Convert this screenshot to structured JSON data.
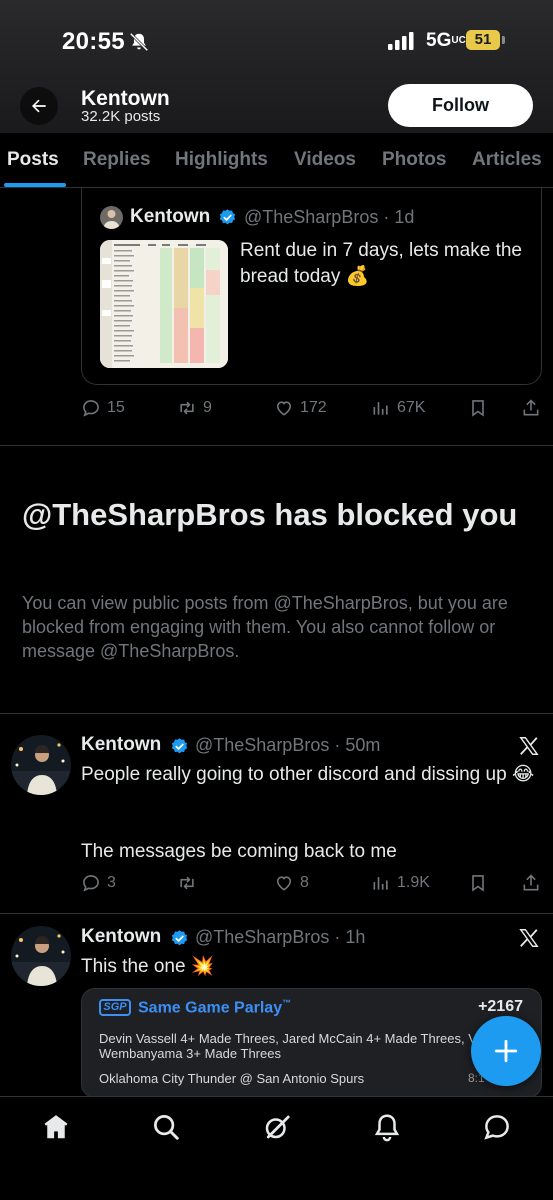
{
  "status_bar": {
    "time": "20:55",
    "network": "5G",
    "network_suffix": "UC",
    "battery": "51",
    "battery_color": "#e8c94a"
  },
  "header": {
    "back_icon": "arrow-left-icon",
    "name": "Kentown",
    "posts_count": "32.2K posts",
    "follow_label": "Follow"
  },
  "tabs": [
    {
      "label": "Posts",
      "active": true
    },
    {
      "label": "Replies"
    },
    {
      "label": "Highlights"
    },
    {
      "label": "Videos"
    },
    {
      "label": "Photos"
    },
    {
      "label": "Articles"
    }
  ],
  "accent_color": "#1d9bf0",
  "quoted_post": {
    "name": "Kentown",
    "handle": "@TheSharpBros · 1d",
    "text": "Rent due in 7 days, lets make the bread today 💰",
    "stats": {
      "replies": "15",
      "reposts": "9",
      "likes": "172",
      "views": "67K"
    }
  },
  "blocked": {
    "title": "@TheSharpBros has blocked you",
    "description": "You can view public posts from @TheSharpBros, but you are blocked from engaging with them. You also cannot follow or message @TheSharpBros."
  },
  "posts": [
    {
      "name": "Kentown",
      "handle": "@TheSharpBros · 50m",
      "line1": "People really going to other discord and dissing up 😂",
      "line2": "The messages be coming back to me",
      "stats": {
        "replies": "3",
        "reposts": "",
        "likes": "8",
        "views": "1.9K"
      }
    },
    {
      "name": "Kentown",
      "handle": "@TheSharpBros · 1h",
      "line1": "This the one 💥",
      "parlay": {
        "badge": "SGP",
        "title": "Same Game Parlay",
        "tm": "™",
        "odds": "+2167",
        "legs": "Devin Vassell 4+ Made Threes, Jared McCain 4+ Made Threes, Victor\nWembanyama 3+ Made Threes",
        "game": "Oklahoma City Thunder @ San Antonio Spurs",
        "time": "8:1"
      }
    }
  ],
  "bottom_nav": [
    "home-icon",
    "search-icon",
    "grok-icon",
    "notifications-icon",
    "messages-icon"
  ]
}
